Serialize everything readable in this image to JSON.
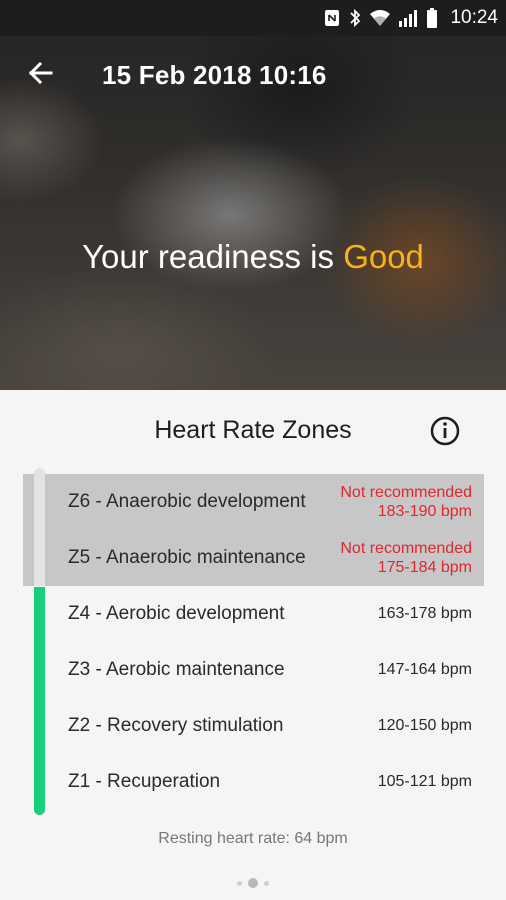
{
  "status_bar": {
    "time": "10:24",
    "icons": [
      "nfc-icon",
      "bluetooth-icon",
      "wifi-icon",
      "signal-icon",
      "battery-icon"
    ]
  },
  "header": {
    "title": "15 Feb 2018 10:16",
    "back_icon": "arrow-back-icon"
  },
  "readiness": {
    "prefix": "Your readiness is",
    "value": "Good",
    "value_color": "#f5b21c"
  },
  "zones_section": {
    "title": "Heart Rate Zones",
    "info_icon": "info-icon",
    "zones": [
      {
        "label": "Z6 - Anaerobic development",
        "bpm": "183-190 bpm",
        "note": "Not recommended",
        "recommended": false
      },
      {
        "label": "Z5 - Anaerobic maintenance",
        "bpm": "175-184 bpm",
        "note": "Not recommended",
        "recommended": false
      },
      {
        "label": "Z4 - Aerobic development",
        "bpm": "163-178 bpm",
        "note": "",
        "recommended": true
      },
      {
        "label": "Z3 - Aerobic maintenance",
        "bpm": "147-164 bpm",
        "note": "",
        "recommended": true
      },
      {
        "label": "Z2 - Recovery stimulation",
        "bpm": "120-150 bpm",
        "note": "",
        "recommended": true
      },
      {
        "label": "Z1 - Recuperation",
        "bpm": "105-121 bpm",
        "note": "",
        "recommended": true
      }
    ],
    "resting_heart_rate": "Resting heart rate: 64 bpm"
  },
  "pager": {
    "pages": 3,
    "active": 1
  },
  "colors": {
    "accent_green": "#19d07a",
    "warning_red": "#e0262f",
    "highlight_yellow": "#f5b21c"
  }
}
